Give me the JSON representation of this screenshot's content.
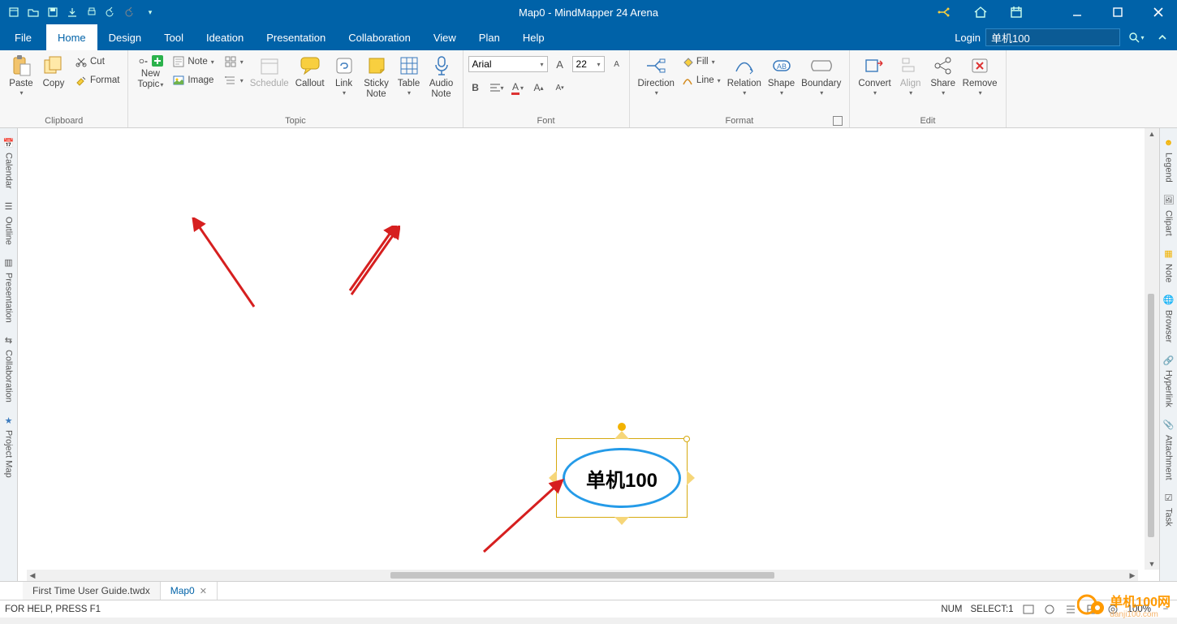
{
  "app": {
    "title": "Map0 -  MindMapper 24 Arena"
  },
  "menubar": {
    "items": [
      "File",
      "Home",
      "Design",
      "Tool",
      "Ideation",
      "Presentation",
      "Collaboration",
      "View",
      "Plan",
      "Help"
    ],
    "active": 1,
    "login": "Login",
    "search_value": "单机100"
  },
  "ribbon": {
    "clipboard": {
      "label": "Clipboard",
      "paste": "Paste",
      "copy": "Copy",
      "cut": "Cut",
      "format": "Format"
    },
    "topic": {
      "label": "Topic",
      "new_topic1": "New",
      "new_topic2": "Topic",
      "note": "Note",
      "image": "Image",
      "schedule": "Schedule",
      "callout": "Callout",
      "link": "Link",
      "sticky1": "Sticky",
      "sticky2": "Note",
      "table": "Table",
      "audio1": "Audio",
      "audio2": "Note"
    },
    "font": {
      "label": "Font",
      "name": "Arial",
      "size": "22"
    },
    "format": {
      "label": "Format",
      "direction": "Direction",
      "fill": "Fill",
      "line": "Line",
      "relation": "Relation",
      "shape": "Shape",
      "boundary": "Boundary"
    },
    "edit": {
      "label": "Edit",
      "convert": "Convert",
      "align": "Align",
      "share": "Share",
      "remove": "Remove"
    }
  },
  "left_rail": [
    "Calendar",
    "Outline",
    "Presentation",
    "Collaboration",
    "Project Map"
  ],
  "right_rail": [
    "Legend",
    "Clipart",
    "Note",
    "Browser",
    "Hyperlink",
    "Attachment",
    "Task"
  ],
  "canvas": {
    "topic_text": "单机100"
  },
  "doc_tabs": {
    "t1": "First Time User Guide.twdx",
    "t2": "Map0"
  },
  "status": {
    "help": "FOR HELP, PRESS F1",
    "num": "NUM",
    "select": "SELECT:1",
    "zoom": "100%"
  },
  "watermark": {
    "big": "单机100网",
    "small": "danji100.com"
  }
}
